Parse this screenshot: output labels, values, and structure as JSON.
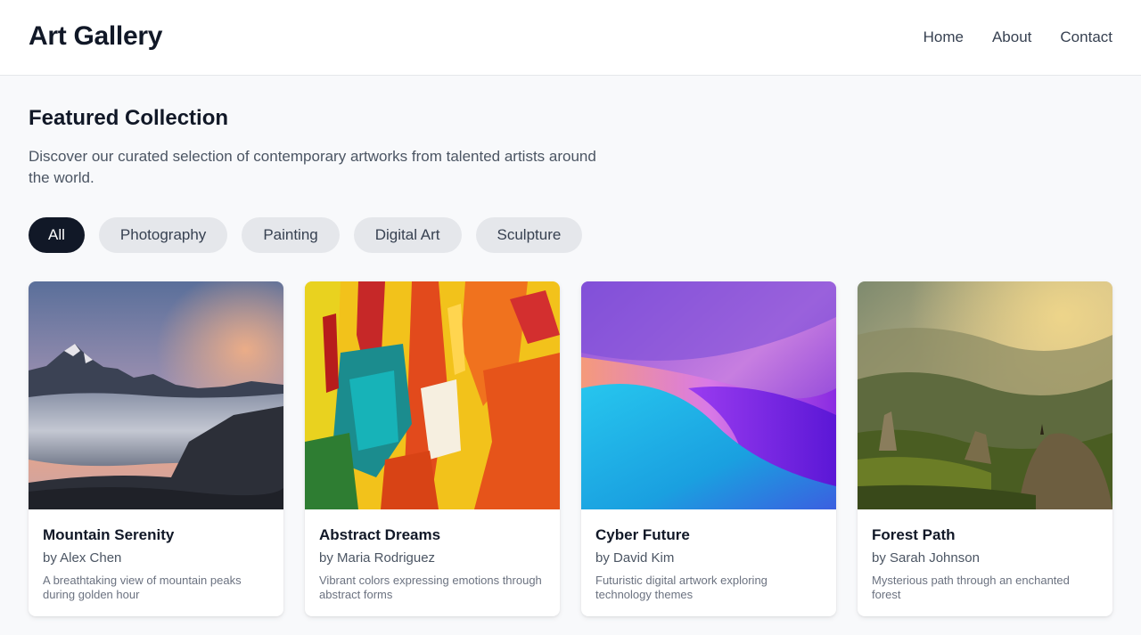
{
  "header": {
    "logo": "Art Gallery",
    "nav": [
      "Home",
      "About",
      "Contact"
    ]
  },
  "featured": {
    "title": "Featured Collection",
    "description": "Discover our curated selection of contemporary artworks from talented artists around the world."
  },
  "filters": {
    "active": "All",
    "items": [
      "All",
      "Photography",
      "Painting",
      "Digital Art",
      "Sculpture"
    ]
  },
  "artworks": [
    {
      "title": "Mountain Serenity",
      "artist": "by Alex Chen",
      "description": "A breathtaking view of mountain peaks during golden hour",
      "image": "mountain-sunset-clouds-photo"
    },
    {
      "title": "Abstract Dreams",
      "artist": "by Maria Rodriguez",
      "description": "Vibrant colors expressing emotions through abstract forms",
      "image": "abstract-paint-strokes"
    },
    {
      "title": "Cyber Future",
      "artist": "by David Kim",
      "description": "Futuristic digital artwork exploring technology themes",
      "image": "purple-blue-gradient-waves"
    },
    {
      "title": "Forest Path",
      "artist": "by Sarah Johnson",
      "description": "Mysterious path through an enchanted forest",
      "image": "misty-green-mountains-photo"
    }
  ],
  "colors": {
    "accent": "#111827",
    "pill": "#e5e7eb",
    "background": "#f8f9fb"
  }
}
